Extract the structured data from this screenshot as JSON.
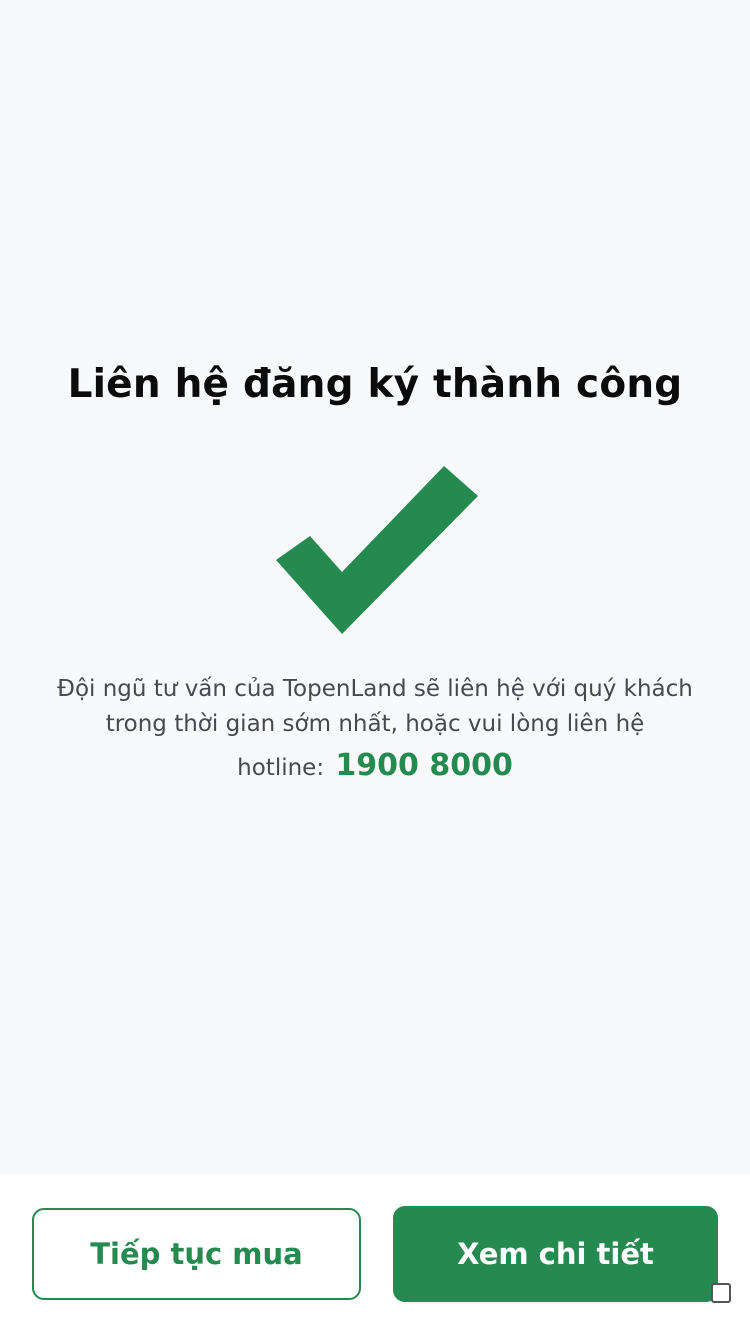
{
  "success": {
    "title": "Liên hệ đăng ký thành công",
    "message_line1": "Đội ngũ tư vấn của TopenLand sẽ liên hệ với quý khách",
    "message_line2": "trong thời gian sớm nhất, hoặc vui lòng liên hệ",
    "hotline_label": "hotline:",
    "hotline_number": "1900 8000",
    "check_icon": "checkmark-icon",
    "accent_color": "#258a4f"
  },
  "footer": {
    "continue_label": "Tiếp tục mua",
    "details_label": "Xem chi tiết",
    "corner_icon": "square-icon"
  }
}
